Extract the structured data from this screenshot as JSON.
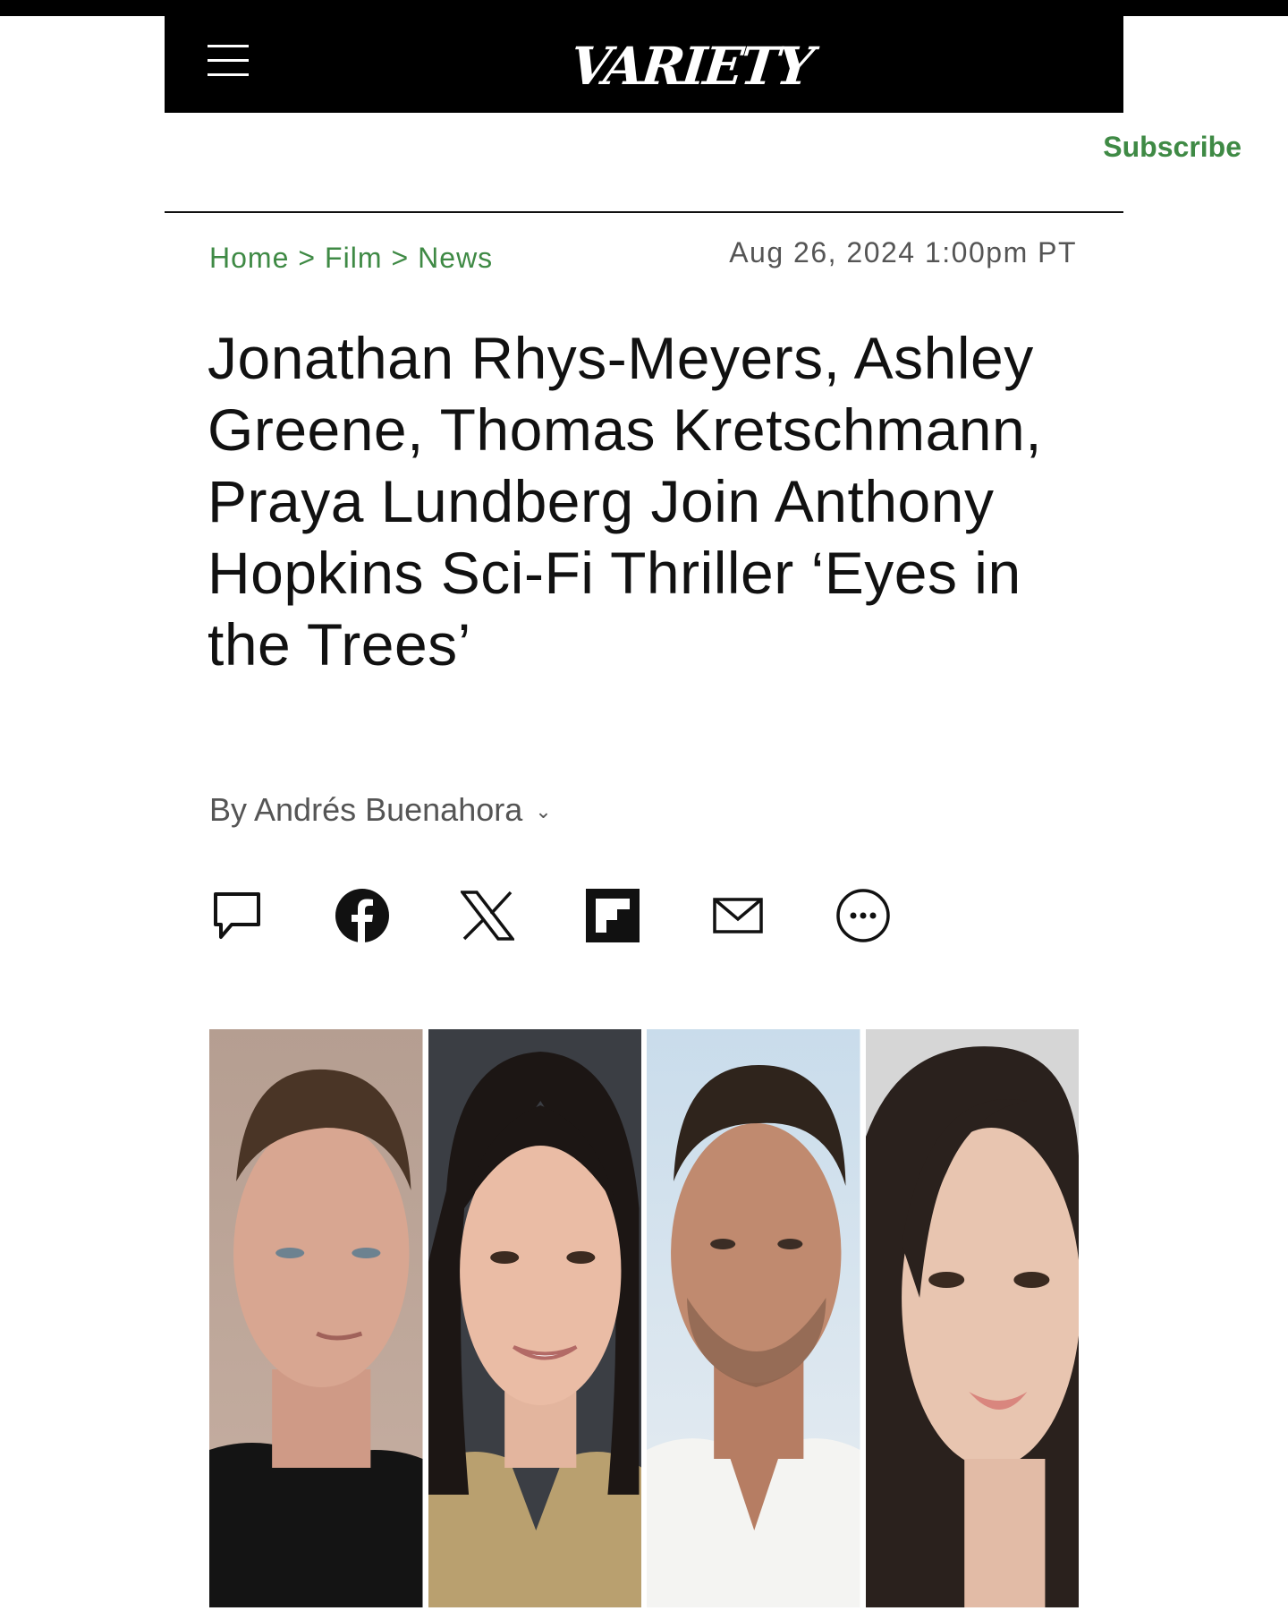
{
  "site": {
    "name": "Variety",
    "logo_text": "VARIETY",
    "menu_icon": "hamburger-menu-icon"
  },
  "header": {
    "subscribe_label": "Subscribe"
  },
  "breadcrumb": {
    "items": [
      "Home",
      "Film",
      "News"
    ],
    "separator": ">"
  },
  "article": {
    "date": "Aug 26, 2024 1:00pm PT",
    "headline": "Jonathan Rhys-Meyers, Ashley Greene, Thomas Kretschmann, Praya Lundberg Join Anthony Hopkins Sci-Fi Thriller ‘Eyes in the Trees’",
    "byline": "By Andrés Buenahora",
    "byline_chevron": "⌄"
  },
  "share": {
    "buttons": [
      {
        "icon": "comment-icon"
      },
      {
        "icon": "facebook-icon"
      },
      {
        "icon": "x-twitter-icon"
      },
      {
        "icon": "flipboard-icon"
      },
      {
        "icon": "email-icon"
      },
      {
        "icon": "more-options-icon"
      }
    ]
  },
  "colors": {
    "accent_green": "#3f8a45",
    "masthead_bg": "#000000",
    "text_primary": "#111111",
    "text_secondary": "#555555"
  }
}
